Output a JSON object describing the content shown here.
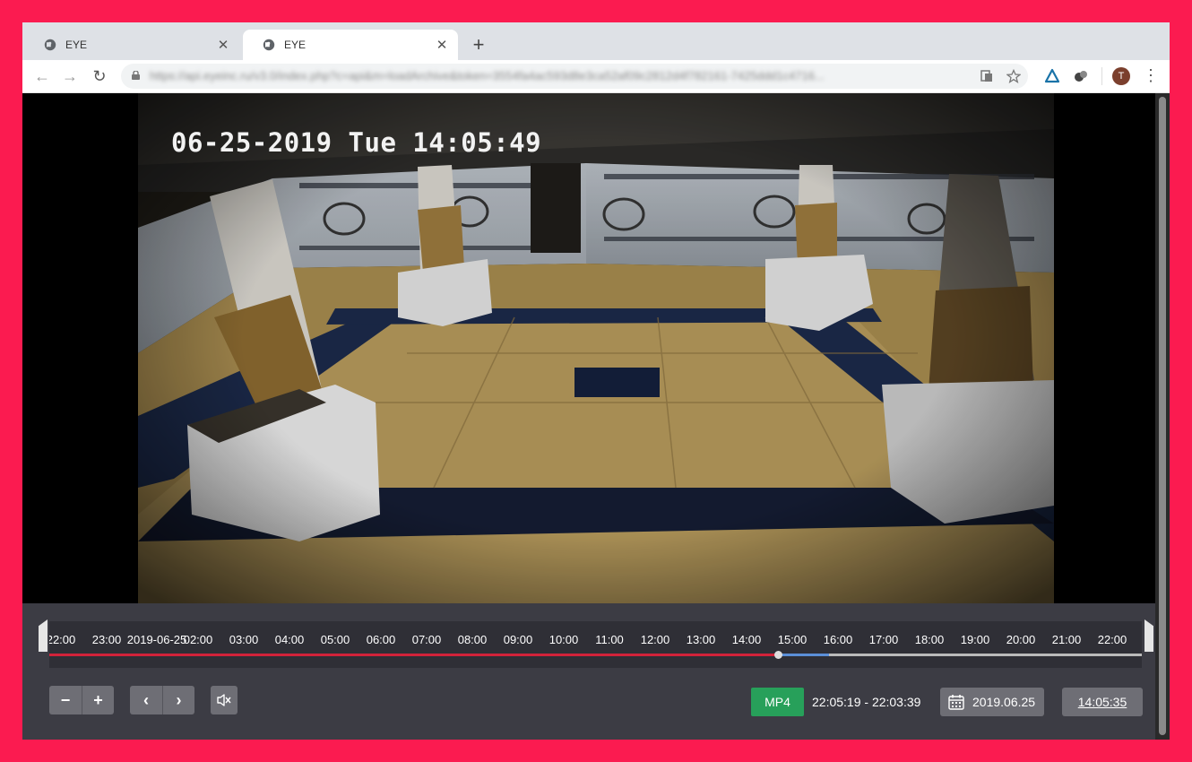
{
  "browser": {
    "tabs": [
      {
        "title": "EYE",
        "active": false
      },
      {
        "title": "EYE",
        "active": true
      }
    ],
    "new_tab_icon": "plus-icon",
    "url": "https://api.eyeinc.ru/v3.0/index.php?c=api&m=loadArchive&token=3554fa4ac593d8e3ca52af09c2812d4f782161-7425ddd1c4716...",
    "profile_initial": "T"
  },
  "player": {
    "overlay_timestamp": "06-25-2019 Tue 14:05:49",
    "timeline_labels": [
      "22:00",
      "23:00",
      "2019-06-25",
      "02:00",
      "03:00",
      "04:00",
      "05:00",
      "06:00",
      "07:00",
      "08:00",
      "09:00",
      "10:00",
      "11:00",
      "12:00",
      "13:00",
      "14:00",
      "15:00",
      "16:00",
      "17:00",
      "18:00",
      "19:00",
      "20:00",
      "21:00",
      "22:00"
    ],
    "playhead_fraction": 0.667,
    "buffered_end_fraction": 0.714,
    "controls": {
      "zoom_out": "−",
      "zoom_in": "+",
      "prev": "‹",
      "next": "›",
      "mute_icon": "speaker-muted-icon"
    },
    "format_label": "MP4",
    "archive_range": "22:05:19 - 22:03:39",
    "date": "2019.06.25",
    "time": "14:05:35"
  },
  "colors": {
    "frame": "#fb1b50",
    "player_bg": "#3c3c44",
    "timeline_recorded": "#d2233a",
    "timeline_buffered": "#5b8fd8",
    "mp4_button": "#27a05a"
  }
}
